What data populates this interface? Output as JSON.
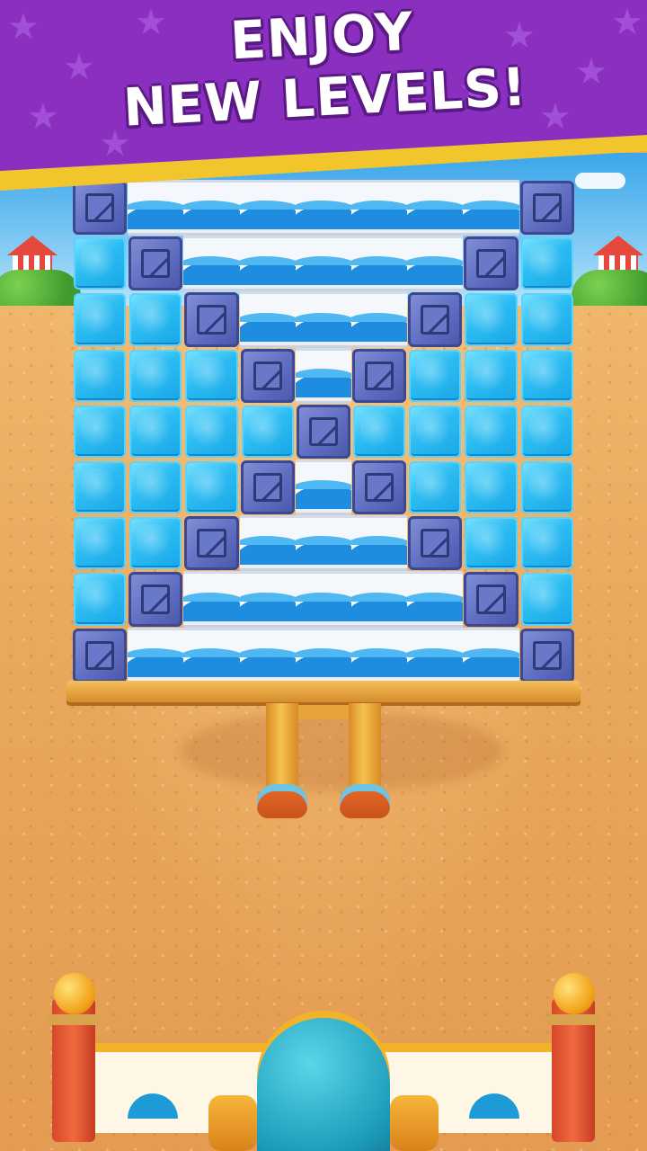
{
  "banner": {
    "line1": "ENJOY",
    "line2": "NEW LEVELS!"
  },
  "colors": {
    "banner_purple": "#8a2fc0",
    "banner_stripe": "#f3c52d",
    "ice_blue": "#2cbcf2",
    "crate_blue": "#5d6bc0",
    "water_blue": "#1e8de0",
    "sand": "#e9a85c"
  },
  "board": {
    "columns": 9,
    "rows": 9,
    "legend": {
      "I": "ice-block",
      "C": "crate-block",
      "W": "water-block"
    },
    "grid": [
      "CWWWWWWWC",
      "ICWWWWWCI",
      "IICWWWCII",
      "IIICWCIII",
      "IIIICIIII",
      "IIICWCIII",
      "IICWWWCII",
      "ICWWWWWCI",
      "CWWWWWWWC"
    ]
  },
  "icons": {
    "cannon": "cannon-icon",
    "crate": "crate-icon",
    "ice": "ice-icon",
    "water": "water-icon"
  }
}
